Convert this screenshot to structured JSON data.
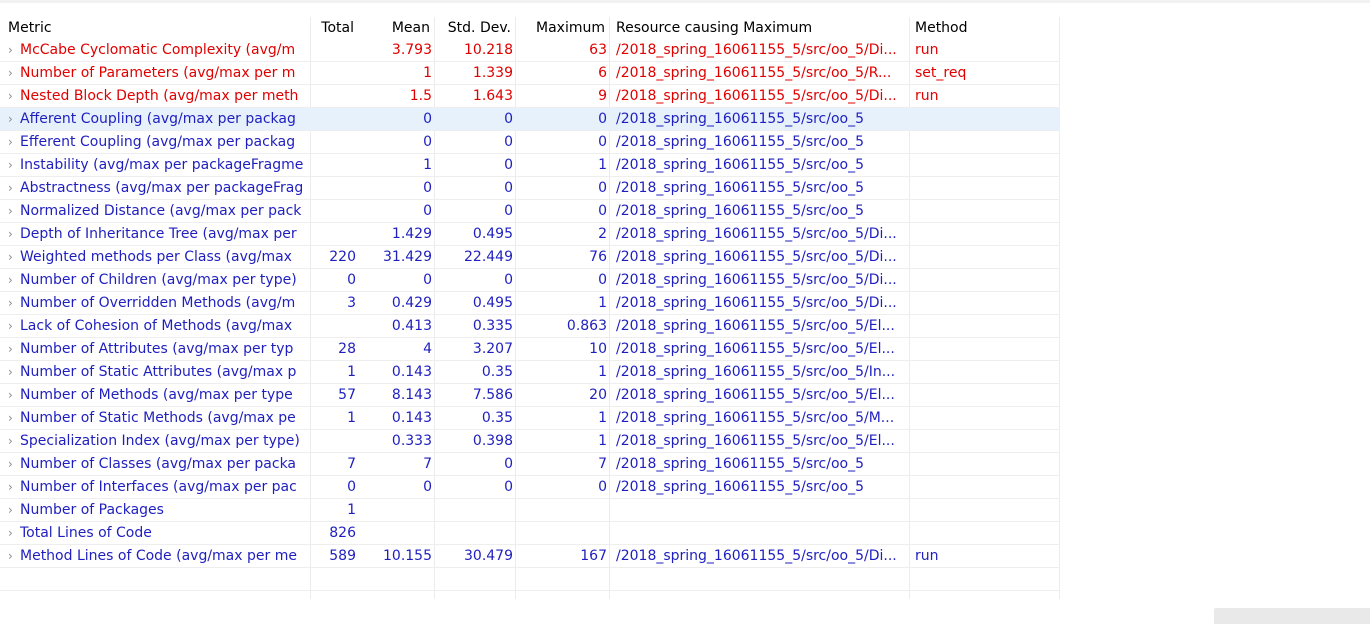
{
  "columns": {
    "metric": "Metric",
    "total": "Total",
    "mean": "Mean",
    "std": "Std. Dev.",
    "maximum": "Maximum",
    "resource": "Resource causing Maximum",
    "method": "Method"
  },
  "colors": {
    "warning": "#e00000",
    "normal": "#1f1fbf",
    "selected_row": "#e6f1fb"
  },
  "icons": {
    "expand": "chevron-right-icon"
  },
  "rows": [
    {
      "metric": "McCabe Cyclomatic Complexity (avg/m",
      "total": "",
      "mean": "3.793",
      "std": "10.218",
      "max": "63",
      "resource": "/2018_spring_16061155_5/src/oo_5/Di...",
      "method": "run",
      "red": true,
      "selected": false
    },
    {
      "metric": "Number of Parameters (avg/max per m",
      "total": "",
      "mean": "1",
      "std": "1.339",
      "max": "6",
      "resource": "/2018_spring_16061155_5/src/oo_5/R...",
      "method": "set_req",
      "red": true,
      "selected": false
    },
    {
      "metric": "Nested Block Depth (avg/max per meth",
      "total": "",
      "mean": "1.5",
      "std": "1.643",
      "max": "9",
      "resource": "/2018_spring_16061155_5/src/oo_5/Di...",
      "method": "run",
      "red": true,
      "selected": false
    },
    {
      "metric": "Afferent Coupling (avg/max per packag",
      "total": "",
      "mean": "0",
      "std": "0",
      "max": "0",
      "resource": "/2018_spring_16061155_5/src/oo_5",
      "method": "",
      "red": false,
      "selected": true
    },
    {
      "metric": "Efferent Coupling (avg/max per packag",
      "total": "",
      "mean": "0",
      "std": "0",
      "max": "0",
      "resource": "/2018_spring_16061155_5/src/oo_5",
      "method": "",
      "red": false,
      "selected": false
    },
    {
      "metric": "Instability (avg/max per packageFragme",
      "total": "",
      "mean": "1",
      "std": "0",
      "max": "1",
      "resource": "/2018_spring_16061155_5/src/oo_5",
      "method": "",
      "red": false,
      "selected": false
    },
    {
      "metric": "Abstractness (avg/max per packageFrag",
      "total": "",
      "mean": "0",
      "std": "0",
      "max": "0",
      "resource": "/2018_spring_16061155_5/src/oo_5",
      "method": "",
      "red": false,
      "selected": false
    },
    {
      "metric": "Normalized Distance (avg/max per pack",
      "total": "",
      "mean": "0",
      "std": "0",
      "max": "0",
      "resource": "/2018_spring_16061155_5/src/oo_5",
      "method": "",
      "red": false,
      "selected": false
    },
    {
      "metric": "Depth of Inheritance Tree (avg/max per",
      "total": "",
      "mean": "1.429",
      "std": "0.495",
      "max": "2",
      "resource": "/2018_spring_16061155_5/src/oo_5/Di...",
      "method": "",
      "red": false,
      "selected": false
    },
    {
      "metric": "Weighted methods per Class (avg/max",
      "total": "220",
      "mean": "31.429",
      "std": "22.449",
      "max": "76",
      "resource": "/2018_spring_16061155_5/src/oo_5/Di...",
      "method": "",
      "red": false,
      "selected": false
    },
    {
      "metric": "Number of Children (avg/max per type)",
      "total": "0",
      "mean": "0",
      "std": "0",
      "max": "0",
      "resource": "/2018_spring_16061155_5/src/oo_5/Di...",
      "method": "",
      "red": false,
      "selected": false
    },
    {
      "metric": "Number of Overridden Methods (avg/m",
      "total": "3",
      "mean": "0.429",
      "std": "0.495",
      "max": "1",
      "resource": "/2018_spring_16061155_5/src/oo_5/Di...",
      "method": "",
      "red": false,
      "selected": false
    },
    {
      "metric": "Lack of Cohesion of Methods (avg/max",
      "total": "",
      "mean": "0.413",
      "std": "0.335",
      "max": "0.863",
      "resource": "/2018_spring_16061155_5/src/oo_5/El...",
      "method": "",
      "red": false,
      "selected": false
    },
    {
      "metric": "Number of Attributes (avg/max per typ",
      "total": "28",
      "mean": "4",
      "std": "3.207",
      "max": "10",
      "resource": "/2018_spring_16061155_5/src/oo_5/El...",
      "method": "",
      "red": false,
      "selected": false
    },
    {
      "metric": "Number of Static Attributes (avg/max p",
      "total": "1",
      "mean": "0.143",
      "std": "0.35",
      "max": "1",
      "resource": "/2018_spring_16061155_5/src/oo_5/In...",
      "method": "",
      "red": false,
      "selected": false
    },
    {
      "metric": "Number of Methods (avg/max per type",
      "total": "57",
      "mean": "8.143",
      "std": "7.586",
      "max": "20",
      "resource": "/2018_spring_16061155_5/src/oo_5/El...",
      "method": "",
      "red": false,
      "selected": false
    },
    {
      "metric": "Number of Static Methods (avg/max pe",
      "total": "1",
      "mean": "0.143",
      "std": "0.35",
      "max": "1",
      "resource": "/2018_spring_16061155_5/src/oo_5/M...",
      "method": "",
      "red": false,
      "selected": false
    },
    {
      "metric": "Specialization Index (avg/max per type)",
      "total": "",
      "mean": "0.333",
      "std": "0.398",
      "max": "1",
      "resource": "/2018_spring_16061155_5/src/oo_5/El...",
      "method": "",
      "red": false,
      "selected": false
    },
    {
      "metric": "Number of Classes (avg/max per packa",
      "total": "7",
      "mean": "7",
      "std": "0",
      "max": "7",
      "resource": "/2018_spring_16061155_5/src/oo_5",
      "method": "",
      "red": false,
      "selected": false
    },
    {
      "metric": "Number of Interfaces (avg/max per pac",
      "total": "0",
      "mean": "0",
      "std": "0",
      "max": "0",
      "resource": "/2018_spring_16061155_5/src/oo_5",
      "method": "",
      "red": false,
      "selected": false
    },
    {
      "metric": "Number of Packages",
      "total": "1",
      "mean": "",
      "std": "",
      "max": "",
      "resource": "",
      "method": "",
      "red": false,
      "selected": false
    },
    {
      "metric": "Total Lines of Code",
      "total": "826",
      "mean": "",
      "std": "",
      "max": "",
      "resource": "",
      "method": "",
      "red": false,
      "selected": false
    },
    {
      "metric": "Method Lines of Code (avg/max per me",
      "total": "589",
      "mean": "10.155",
      "std": "30.479",
      "max": "167",
      "resource": "/2018_spring_16061155_5/src/oo_5/Di...",
      "method": "run",
      "red": false,
      "selected": false
    }
  ]
}
